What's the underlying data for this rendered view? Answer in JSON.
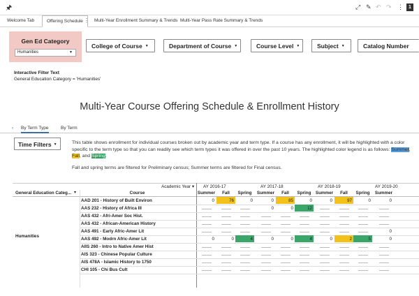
{
  "toolbar": {
    "page_number": "1"
  },
  "tabs": [
    {
      "label": "Welcome Tab"
    },
    {
      "label": "Offering Schedule"
    },
    {
      "label": "Multi-Year Enrollment Summary & Trends"
    },
    {
      "label": "Multi-Year Pass Rate Summary & Trends"
    }
  ],
  "filters": {
    "gen_ed": {
      "title": "Gen Ed Category",
      "value": "Humanities"
    },
    "buttons": [
      {
        "label": "College of Course"
      },
      {
        "label": "Department of Course"
      },
      {
        "label": "Course Level"
      },
      {
        "label": "Subject"
      },
      {
        "label": "Catalog Number"
      }
    ]
  },
  "filter_text": {
    "title": "Interactive Filter Text",
    "value": "General Education Category = 'Humanities'"
  },
  "page_title": "Multi-Year Course Offering Schedule & Enrollment History",
  "subtabs": [
    {
      "label": "By Term Type"
    },
    {
      "label": "By Term"
    }
  ],
  "time_filters": {
    "label": "Time Filters"
  },
  "description": {
    "part1": "This table shows enrollment for individual courses broken out by academic year and term type. If a course has any enrollment, it will be highlighted with a color specific to the term type so that you can readily see which term types it was offered in over the past 10 years. The highlighted color legend is as follows: ",
    "summer": "Summer",
    "sep1": ", ",
    "fall": "Fall",
    "sep2": ", and ",
    "spring": "Spring",
    "end": ".",
    "note": "Fall and spring terms are filtered for Preliminary census; Summer terms are filtered for Final census."
  },
  "colors": {
    "summer": "#5b9bd5",
    "fall": "#f2c11a",
    "spring": "#3aa66a",
    "filter_bg": "#f2c9c4"
  },
  "table": {
    "academic_year_label": "Academic Year",
    "col_category": "General Education Categ...",
    "col_course": "Course",
    "years": [
      "AY 2016-17",
      "AY 2017-18",
      "AY 2018-19",
      "AY 2019-20"
    ],
    "term_types": [
      "Summer",
      "Fall",
      "Spring"
    ],
    "category": "Humanities",
    "rows": [
      {
        "course": "AAD 201 - History of Built Environ",
        "cells": [
          "0",
          "76",
          "0",
          "0",
          "85",
          "0",
          "0",
          "97",
          "0",
          "0"
        ]
      },
      {
        "course": "AAS 232 - History of Africa III",
        "cells": [
          "",
          "",
          "",
          "0",
          "0",
          "12",
          "",
          "",
          "",
          ""
        ]
      },
      {
        "course": "AAS 432 - Afri-Amer Soc Hist.",
        "cells": [
          "",
          "",
          "",
          "",
          "",
          "",
          "",
          "",
          "",
          ""
        ]
      },
      {
        "course": "AAS 432 - African-American History",
        "cells": [
          "",
          "",
          "",
          "",
          "",
          "",
          "",
          "",
          "",
          ""
        ]
      },
      {
        "course": "AAS 491 - Early Afric-Amer Lit",
        "cells": [
          "",
          "",
          "",
          "",
          "",
          "",
          "",
          "",
          "",
          "0"
        ]
      },
      {
        "course": "AAS 492 - Modrn Afric-Amer Lit",
        "cells": [
          "0",
          "0",
          "4",
          "0",
          "0",
          "4",
          "0",
          "2",
          "5",
          "0"
        ]
      },
      {
        "course": "AIIS 260 - Intro to Native Amer Hist",
        "cells": [
          "",
          "",
          "",
          "",
          "",
          "",
          "",
          "",
          "",
          ""
        ]
      },
      {
        "course": "AIS 323 - Chinese Popular Culture",
        "cells": [
          "",
          "",
          "",
          "",
          "",
          "",
          "",
          "",
          "",
          ""
        ]
      },
      {
        "course": "AIS 478A - Islamic History to 1750",
        "cells": [
          "",
          "",
          "",
          "",
          "",
          "",
          "",
          "",
          "",
          ""
        ]
      },
      {
        "course": "CHI 105 - Chi Bus Cult",
        "cells": [
          "",
          "",
          "",
          "",
          "",
          "",
          "",
          "",
          "",
          ""
        ]
      }
    ]
  }
}
